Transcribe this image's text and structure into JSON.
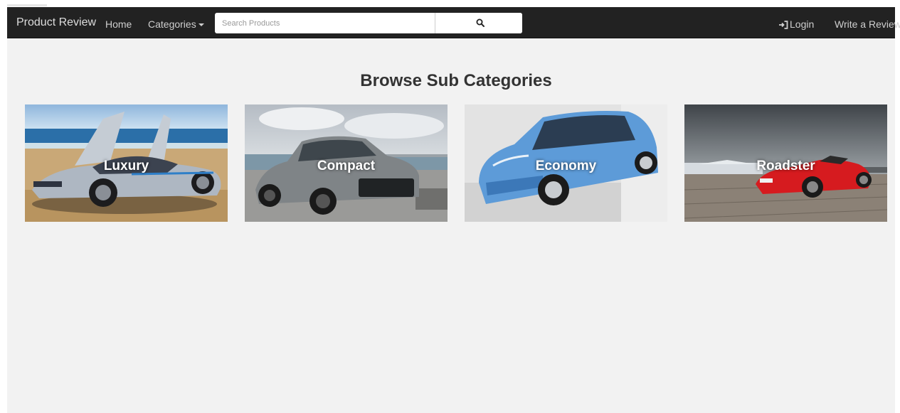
{
  "navbar": {
    "brand": "Product Review",
    "home": "Home",
    "categories": "Categories",
    "search_placeholder": "Search Products",
    "login": "Login",
    "write_review": "Write a Review"
  },
  "page": {
    "heading": "Browse Sub Categories"
  },
  "categories": [
    {
      "label": "Luxury"
    },
    {
      "label": "Compact"
    },
    {
      "label": "Economy"
    },
    {
      "label": "Roadster"
    }
  ],
  "icons": {
    "search": "search-icon",
    "login": "sign-in-icon",
    "caret": "caret-down-icon"
  },
  "colors": {
    "navbar_bg": "#222222",
    "page_bg": "#f2f2f2",
    "heading": "#333333"
  }
}
